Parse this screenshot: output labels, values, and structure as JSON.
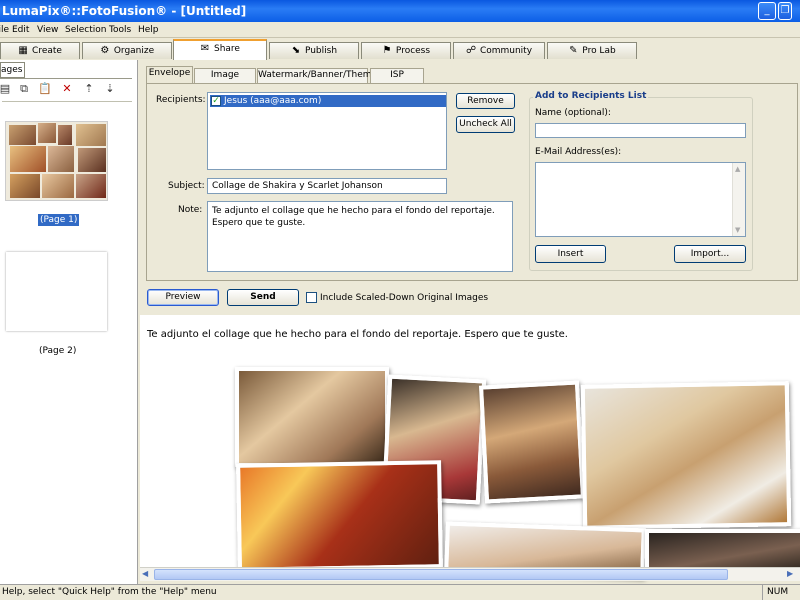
{
  "window": {
    "title": "LumaPix®::FotoFusion® - [Untitled]"
  },
  "menu": [
    "File",
    "Edit",
    "View",
    "Selection",
    "Tools",
    "Help"
  ],
  "main_tabs": [
    {
      "label": "Create",
      "icon": "grid-icon"
    },
    {
      "label": "Organize",
      "icon": "organize-icon"
    },
    {
      "label": "Share",
      "icon": "envelope-icon",
      "active": true
    },
    {
      "label": "Publish",
      "icon": "publish-icon"
    },
    {
      "label": "Process",
      "icon": "process-icon"
    },
    {
      "label": "Community",
      "icon": "community-icon"
    },
    {
      "label": "Pro Lab",
      "icon": "wrench-icon"
    }
  ],
  "left_panel": {
    "tab_label": "ages",
    "toolbar_icons": [
      "new-page-icon",
      "copy-page-icon",
      "paste-page-icon",
      "delete-page-icon",
      "move-up-icon",
      "move-down-icon"
    ],
    "pages": [
      {
        "label": "(Page 1)",
        "selected": true
      },
      {
        "label": "(Page 2)",
        "selected": false
      }
    ]
  },
  "sub_tabs": [
    "Envelope",
    "Image Quality",
    "Watermark/Banner/Theme",
    "ISP Settings"
  ],
  "envelope": {
    "recipients_label": "Recipients:",
    "recipients": [
      {
        "text": "Jesus (aaa@aaa.com)",
        "checked": true
      }
    ],
    "remove_label": "Remove",
    "uncheck_all_label": "Uncheck All",
    "subject_label": "Subject:",
    "subject_value": "Collage de Shakira y Scarlet Johanson",
    "note_label": "Note:",
    "note_value": "Te adjunto el collage que he hecho para el fondo del reportaje. Espero que te guste.",
    "add_group_title": "Add to Recipients List",
    "name_label": "Name (optional):",
    "email_label": "E-Mail Address(es):",
    "insert_label": "Insert",
    "import_label": "Import..."
  },
  "actions": {
    "preview_label": "Preview",
    "send_label": "Send",
    "include_label": "Include Scaled-Down Original Images",
    "include_checked": false
  },
  "preview_text": "Te adjunto el collage que he hecho para el fondo del reportaje. Espero que te guste.",
  "status": {
    "help_text": "Help, select \"Quick Help\" from the \"Help\" menu",
    "num": "NUM"
  },
  "colors": {
    "accent": "#0a58e0",
    "selection": "#316ac5",
    "tab_active_border": "#f0a030"
  }
}
